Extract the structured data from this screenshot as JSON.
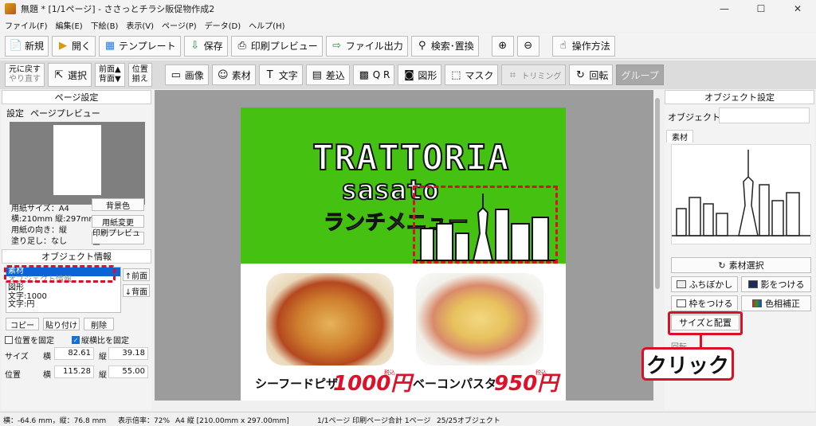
{
  "window": {
    "title": "無題 * [1/1ページ] - ささっとチラシ販促物作成2",
    "controls": [
      "—",
      "☐",
      "✕"
    ]
  },
  "menu": [
    "ファイル(F)",
    "編集(E)",
    "下絵(B)",
    "表示(V)",
    "ページ(P)",
    "データ(D)",
    "ヘルプ(H)"
  ],
  "toolbar1": {
    "new": "新規",
    "open": "開く",
    "template": "テンプレート",
    "save": "保存",
    "print_preview": "印刷プレビュー",
    "export": "ファイル出力",
    "search_replace": "検索･置換",
    "help": "操作方法"
  },
  "toolbar2": {
    "undo": "元に戻す",
    "redo": "やり直す",
    "select": "選択",
    "front": "前面▲",
    "back": "背面▼",
    "align_line1": "位置",
    "align_line2": "揃え",
    "image": "画像",
    "material": "素材",
    "text": "文字",
    "merge": "差込",
    "qr": "Q R",
    "shape": "図形",
    "mask": "マスク",
    "trim": "トリミング",
    "rotate": "回転",
    "group": "グループ"
  },
  "page_settings": {
    "header": "ページ設定",
    "tabs": [
      "設定",
      "ページプレビュー"
    ],
    "paper_size": "用紙サイズ：A4",
    "dimensions": "横:210mm 縦:297mm",
    "orientation": "用紙の向き：縦",
    "bleed": "塗り足し：なし",
    "bg_color_btn": "背景色",
    "paper_change_btn": "用紙変更",
    "print_preview_btn": "印刷プレビュー"
  },
  "object_info": {
    "header": "オブジェクト情報",
    "items": [
      "素材",
      "オブジェクト情報",
      "図形",
      "文字:1000",
      "文字:円"
    ],
    "front_btn": "↑前面",
    "back_btn": "↓背面",
    "copy_btn": "コピー",
    "paste_btn": "貼り付け",
    "delete_btn": "削除",
    "fix_position": "位置を固定",
    "fix_ratio": "縦横比を固定",
    "size_label": "サイズ",
    "pos_label": "位置",
    "w_label": "横",
    "h_label": "縦",
    "size_w": "82.61",
    "size_h": "39.18",
    "pos_x": "115.28",
    "pos_y": "55.00"
  },
  "flyer": {
    "title1": "TRATTORIA",
    "title2": "sasato",
    "title3": "ランチメニュー",
    "item1_name": "シーフードピザ",
    "item1_price": "1000円",
    "item1_tax": "税込",
    "item2_name": "ベーコンパスタ",
    "item2_price": "950円",
    "item2_tax": "税込",
    "green": "#45c112",
    "red": "#e0102a"
  },
  "object_settings": {
    "header": "オブジェクト設定",
    "name_label": "オブジェクト名",
    "material_tab": "素材",
    "material_select": "素材選択",
    "blur": "ふちぼかし",
    "shadow": "影をつける",
    "frame": "枠をつける",
    "color_correct": "色相補正",
    "size_layout": "サイズと配置",
    "rotate_label": "回転"
  },
  "callout": {
    "text": "クリック"
  },
  "statusbar": {
    "coords": "横：-64.6 mm，縦：76.8 mm",
    "zoom": "表示倍率：72%",
    "paper": "A4 縦 [210.00mm x 297.00mm]",
    "pages": "1/1ページ 印刷ページ合計 1ページ",
    "objects": "25/25オブジェクト"
  }
}
